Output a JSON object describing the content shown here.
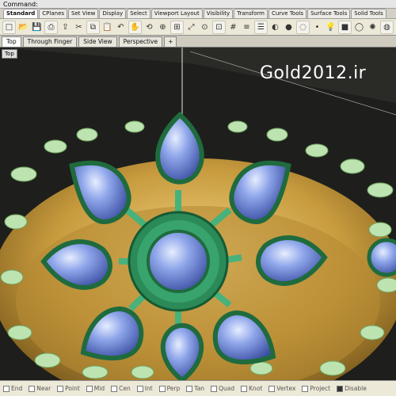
{
  "command": {
    "label": "Command:"
  },
  "toolbar_tabs": [
    "Standard",
    "CPlanes",
    "Set View",
    "Display",
    "Select",
    "Viewport Layout",
    "Visibility",
    "Transform",
    "Curve Tools",
    "Surface Tools",
    "Solid Tools"
  ],
  "toolbar_icons": [
    "new-file-icon",
    "open-folder-icon",
    "save-icon",
    "print-icon",
    "import-icon",
    "cut-icon",
    "copy-icon",
    "paste-icon",
    "undo-icon",
    "pan-hand-icon",
    "rotate-view-icon",
    "zoom-icon",
    "zoom-window-icon",
    "zoom-extents-icon",
    "zoom-selected-icon",
    "viewport-select-icon",
    "grid-icon",
    "layers-icon",
    "properties-icon",
    "render-icon",
    "shade-icon",
    "ghost-icon",
    "point-icon",
    "lightbulb-icon",
    "material-icon",
    "cylinder-icon",
    "color-wheel-icon",
    "sphere-icon"
  ],
  "viewport_tabs": [
    "Top",
    "Through Finger",
    "Side View",
    "Perspective",
    "+"
  ],
  "viewport_label": "Top",
  "watermark": "Gold2012.ir",
  "osnap": [
    {
      "label": "End",
      "checked": false
    },
    {
      "label": "Near",
      "checked": false
    },
    {
      "label": "Point",
      "checked": false
    },
    {
      "label": "Mid",
      "checked": false
    },
    {
      "label": "Cen",
      "checked": false
    },
    {
      "label": "Int",
      "checked": false
    },
    {
      "label": "Perp",
      "checked": false
    },
    {
      "label": "Tan",
      "checked": false
    },
    {
      "label": "Quad",
      "checked": false
    },
    {
      "label": "Knot",
      "checked": false
    },
    {
      "label": "Vertex",
      "checked": false
    },
    {
      "label": "Project",
      "checked": false
    },
    {
      "label": "Disable",
      "checked": true
    }
  ]
}
